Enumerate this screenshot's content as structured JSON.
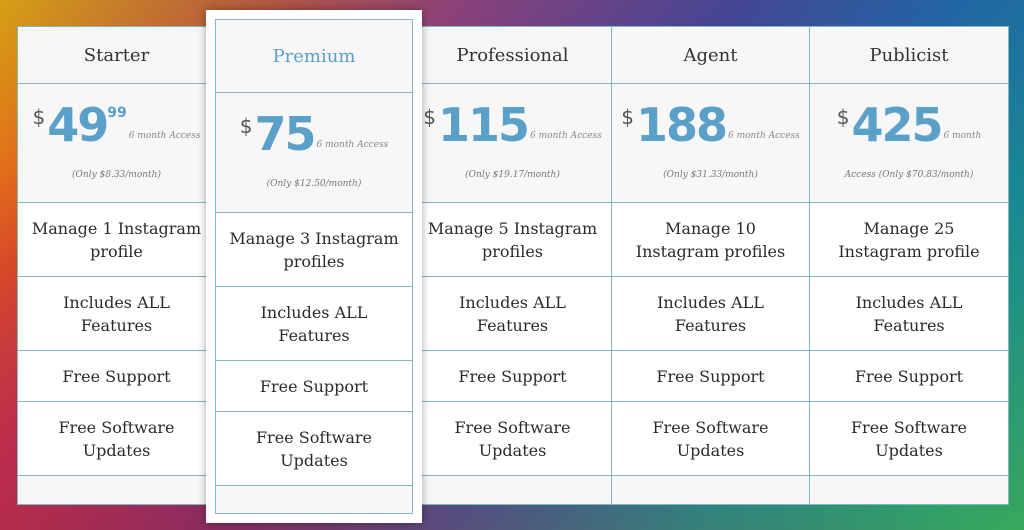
{
  "plans": [
    {
      "name": "Starter",
      "currency": "$",
      "amount": "49",
      "cents": "99",
      "access": "6 month Access",
      "monthly": "(Only $8.33/month)",
      "profiles": "Manage 1 Instagram profile",
      "features": "Includes ALL Features",
      "support": "Free Support",
      "updates": "Free Software Updates"
    },
    {
      "name": "Premium",
      "currency": "$",
      "amount": "75",
      "cents": "",
      "access": "6 month Access",
      "monthly": "(Only $12.50/month)",
      "profiles": "Manage 3 Instagram profiles",
      "features": "Includes ALL Features",
      "support": "Free Support",
      "updates": "Free Software Updates"
    },
    {
      "name": "Professional",
      "currency": "$",
      "amount": "115",
      "cents": "",
      "access": "6 month Access",
      "monthly": "(Only $19.17/month)",
      "profiles": "Manage 5 Instagram profiles",
      "features": "Includes ALL Features",
      "support": "Free Support",
      "updates": "Free Software Updates"
    },
    {
      "name": "Agent",
      "currency": "$",
      "amount": "188",
      "cents": "",
      "access": "6 month Access",
      "monthly": "(Only $31.33/month)",
      "profiles": "Manage 10 Instagram profiles",
      "features": "Includes ALL Features",
      "support": "Free Support",
      "updates": "Free Software Updates"
    },
    {
      "name": "Publicist",
      "currency": "$",
      "amount": "425",
      "cents": "",
      "access": "6 month",
      "monthly": "Access (Only $70.83/month)",
      "profiles": "Manage 25 Instagram profile",
      "features": "Includes ALL Features",
      "support": "Free Support",
      "updates": "Free Software Updates"
    }
  ],
  "colors": {
    "accent": "#5aa0c8",
    "border": "#7fb8bd",
    "header_bg": "#f7f7f7"
  }
}
